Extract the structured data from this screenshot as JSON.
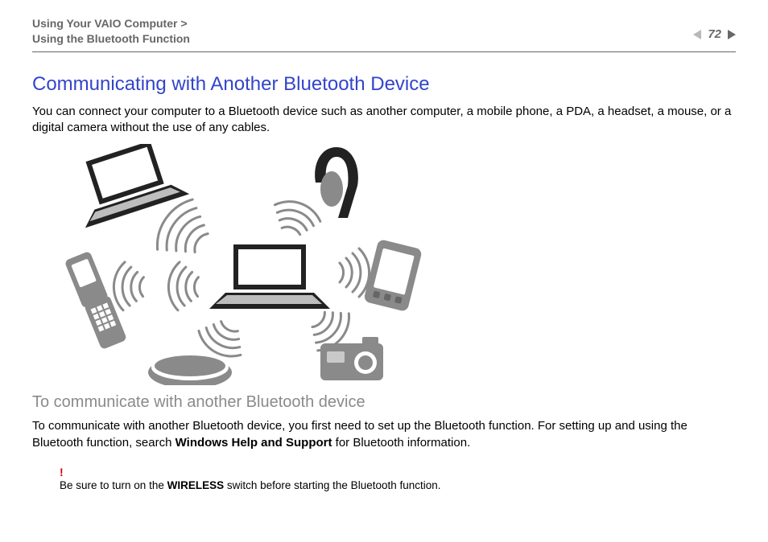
{
  "header": {
    "breadcrumb_line1": "Using Your VAIO Computer >",
    "breadcrumb_line2": "Using the Bluetooth Function",
    "page_number": "72"
  },
  "title": "Communicating with Another Bluetooth Device",
  "intro": "You can connect your computer to a Bluetooth device such as another computer, a mobile phone, a PDA, a headset, a mouse, or a digital camera without the use of any cables.",
  "subhead": "To communicate with another Bluetooth device",
  "para2_a": "To communicate with another Bluetooth device, you first need to set up the Bluetooth function. For setting up and using the Bluetooth function, search ",
  "para2_bold": "Windows Help and Support",
  "para2_b": " for Bluetooth information.",
  "note_bang": "!",
  "note_a": "Be sure to turn on the ",
  "note_bold": "WIRELESS",
  "note_b": " switch before starting the Bluetooth function."
}
